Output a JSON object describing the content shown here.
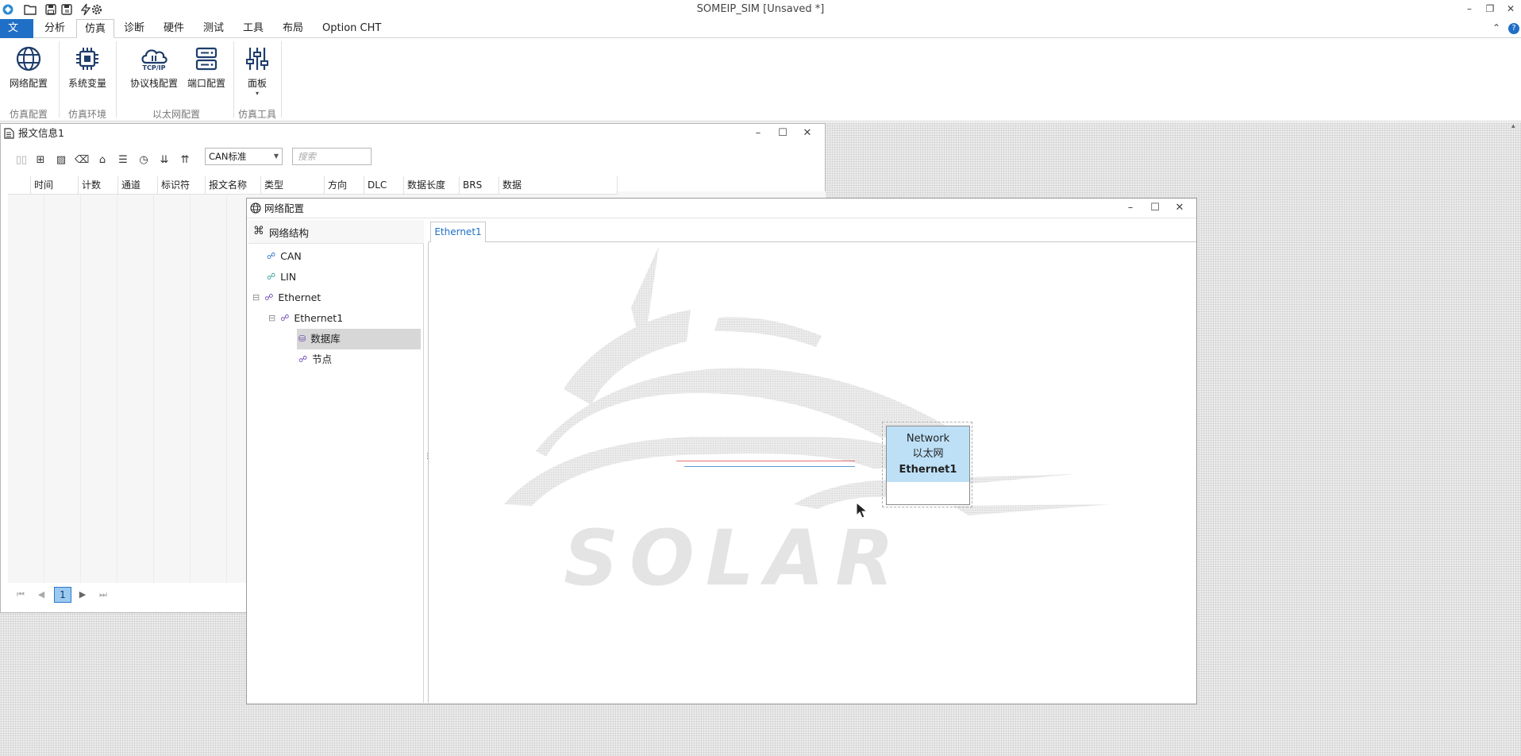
{
  "app": {
    "title": "SOMEIP_SIM [Unsaved *]",
    "quick_access": [
      "logo-icon",
      "folder-open-icon",
      "save-icon",
      "save-as-icon",
      "lightning-icon",
      "gear-icon"
    ]
  },
  "menu": {
    "items": [
      "文件",
      "分析",
      "仿真",
      "诊断",
      "硬件",
      "测试",
      "工具",
      "布局",
      "Option CHT"
    ],
    "active": "仿真"
  },
  "ribbon": {
    "buttons": [
      "网络配置",
      "系统变量",
      "协议栈配置",
      "端口配置",
      "面板"
    ],
    "protocol_icon_text": "TCP/IP",
    "groups": [
      "仿真配置",
      "仿真环境",
      "以太网配置",
      "仿真工具"
    ]
  },
  "message_window": {
    "title": "报文信息1",
    "filter_value": "CAN标准",
    "search_placeholder": "搜索",
    "columns": [
      "时间",
      "计数",
      "通道",
      "标识符",
      "报文名称",
      "类型",
      "方向",
      "DLC",
      "数据长度",
      "BRS",
      "数据"
    ],
    "page": "1"
  },
  "network_window": {
    "title": "网络配置",
    "tree_header": "网络结构",
    "tree": [
      {
        "label": "CAN",
        "level": 0,
        "expander": ""
      },
      {
        "label": "LIN",
        "level": 0,
        "expander": ""
      },
      {
        "label": "Ethernet",
        "level": 0,
        "expander": "⊟"
      },
      {
        "label": "Ethernet1",
        "level": 1,
        "expander": "⊟"
      },
      {
        "label": "数据库",
        "level": 2,
        "expander": "",
        "selected": true
      },
      {
        "label": "节点",
        "level": 2,
        "expander": ""
      }
    ],
    "tab": "Ethernet1",
    "watermark_text": "SOLAR",
    "network_node": {
      "line1": "Network",
      "line2": "以太网",
      "line3": "Ethernet1"
    }
  },
  "colors": {
    "accent": "#1f6fc6",
    "node_fill": "#bde0f7",
    "line_red": "#e57373",
    "line_blue": "#5b9bd5"
  }
}
